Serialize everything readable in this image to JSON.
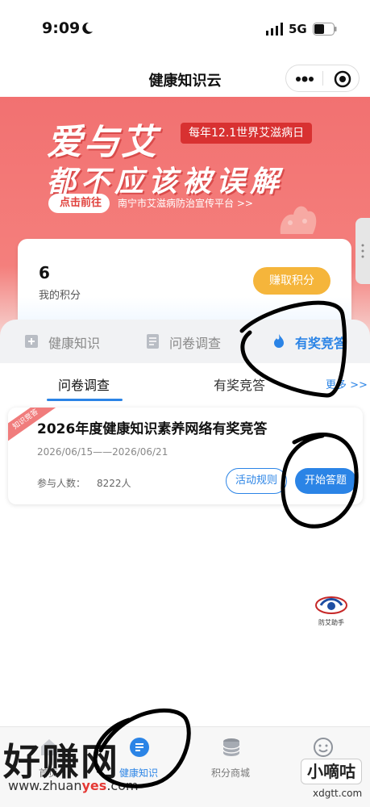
{
  "status_bar": {
    "time": "9:09",
    "network": "5G"
  },
  "nav": {
    "title": "健康知识云"
  },
  "banner": {
    "logo_line1": "爱与艾",
    "logo_line2": "都不应该被误解",
    "date_tag": "每年12.1世界艾滋病日",
    "cta_label": "点击前往",
    "cta_text": "南宁市艾滋病防治宣传平台 >>"
  },
  "points": {
    "value": "6",
    "label": "我的积分",
    "earn_button": "赚取积分"
  },
  "feature_tabs": [
    {
      "label": "健康知识",
      "icon": "add-doc-icon"
    },
    {
      "label": "问卷调查",
      "icon": "survey-icon"
    },
    {
      "label": "有奖竞答",
      "icon": "flame-icon"
    }
  ],
  "sub_tabs": {
    "tab1": "问卷调查",
    "tab2": "有奖竞答",
    "more": "更多 >>"
  },
  "quiz": {
    "ribbon": "知识竞答",
    "title": "2026年度健康知识素养网络有奖竞答",
    "date": "2026/06/15——2026/06/21",
    "count_label": "参与人数：",
    "count_value": "8222人",
    "rules_button": "活动规则",
    "start_button": "开始答题"
  },
  "helper": {
    "label": "防艾助手"
  },
  "tabbar": [
    {
      "label": "首页",
      "icon": "home-icon"
    },
    {
      "label": "健康知识",
      "icon": "knowledge-icon"
    },
    {
      "label": "积分商城",
      "icon": "coins-icon"
    },
    {
      "label": "我的",
      "icon": "user-icon"
    }
  ],
  "watermark": {
    "left_big": "好赚网",
    "left_url_a": "www.zhuan",
    "left_url_b": "yes",
    "left_url_c": ".com",
    "right_big": "小嘀咕",
    "right_url": "xdgtt.com"
  },
  "colors": {
    "accent": "#2b84e6",
    "banner": "#f27171",
    "earn": "#f5b53b"
  }
}
